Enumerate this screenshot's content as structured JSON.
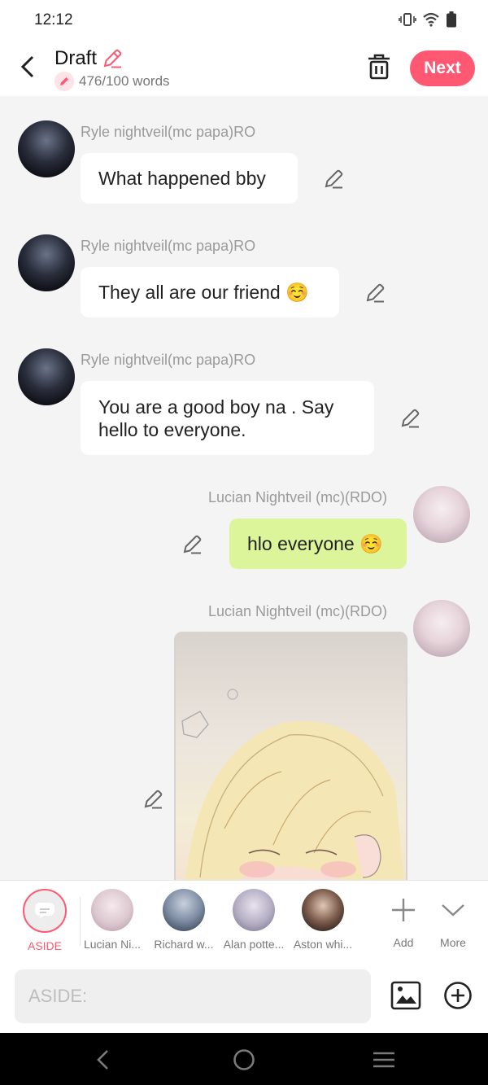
{
  "status": {
    "time": "12:12"
  },
  "header": {
    "title": "Draft",
    "word_count": "476/100 words",
    "next_label": "Next"
  },
  "messages": [
    {
      "sender": "Ryle nightveil(mc papa)RO",
      "text": "What happened bby",
      "side": "left"
    },
    {
      "sender": "Ryle nightveil(mc papa)RO",
      "text": "They all are our friend ☺️",
      "side": "left"
    },
    {
      "sender": "Ryle nightveil(mc papa)RO",
      "text_line1": "You are a good boy na . Say",
      "text_line2": "hello to everyone.",
      "side": "left"
    },
    {
      "sender": "Lucian Nightveil (mc)(RDO)",
      "text": "hlo everyone ☺️",
      "side": "right"
    },
    {
      "sender": "Lucian Nightveil (mc)(RDO)",
      "type": "image",
      "side": "right"
    }
  ],
  "characters": [
    {
      "label": "ASIDE",
      "selected": true
    },
    {
      "label": "Lucian Ni..."
    },
    {
      "label": "Richard w..."
    },
    {
      "label": "Alan potte..."
    },
    {
      "label": "Aston whi..."
    }
  ],
  "actions": {
    "add_label": "Add",
    "more_label": "More"
  },
  "input": {
    "placeholder": "ASIDE:"
  },
  "colors": {
    "accent": "#ff5872",
    "bubble_self": "#dcf59a",
    "background": "#f4f4f4"
  }
}
